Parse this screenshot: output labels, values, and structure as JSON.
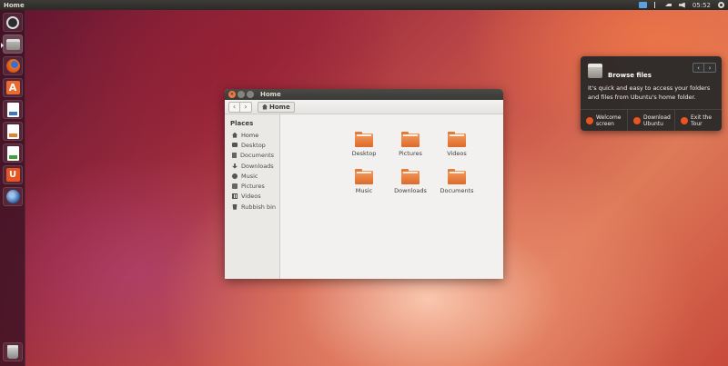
{
  "top_panel": {
    "title": "Home",
    "clock": "05:52"
  },
  "launcher": {
    "items": [
      "dash-home",
      "files",
      "firefox",
      "software-center",
      "libreoffice-writer",
      "libreoffice-impress",
      "libreoffice-calc",
      "ubuntu-one",
      "thunderbird",
      "trash"
    ],
    "software_glyph": "A",
    "ubuntu_one_glyph": "U"
  },
  "window": {
    "title": "Home",
    "back_glyph": "‹",
    "forward_glyph": "›",
    "breadcrumb": "Home",
    "sidebar": {
      "section": "Places",
      "items": [
        "Home",
        "Desktop",
        "Documents",
        "Downloads",
        "Music",
        "Pictures",
        "Videos",
        "Rubbish bin"
      ]
    },
    "files": [
      "Desktop",
      "Pictures",
      "Videos",
      "Music",
      "Downloads",
      "Documents"
    ]
  },
  "tour": {
    "title": "Browse files",
    "prev_glyph": "‹",
    "next_glyph": "›",
    "body": "It's quick and easy to access your folders and files from Ubuntu's home folder.",
    "actions": [
      {
        "label": "Welcome screen"
      },
      {
        "label": "Download Ubuntu"
      },
      {
        "label": "Exit the Tour"
      }
    ]
  },
  "colors": {
    "accent": "#e95420",
    "panel": "#3c3b37"
  }
}
